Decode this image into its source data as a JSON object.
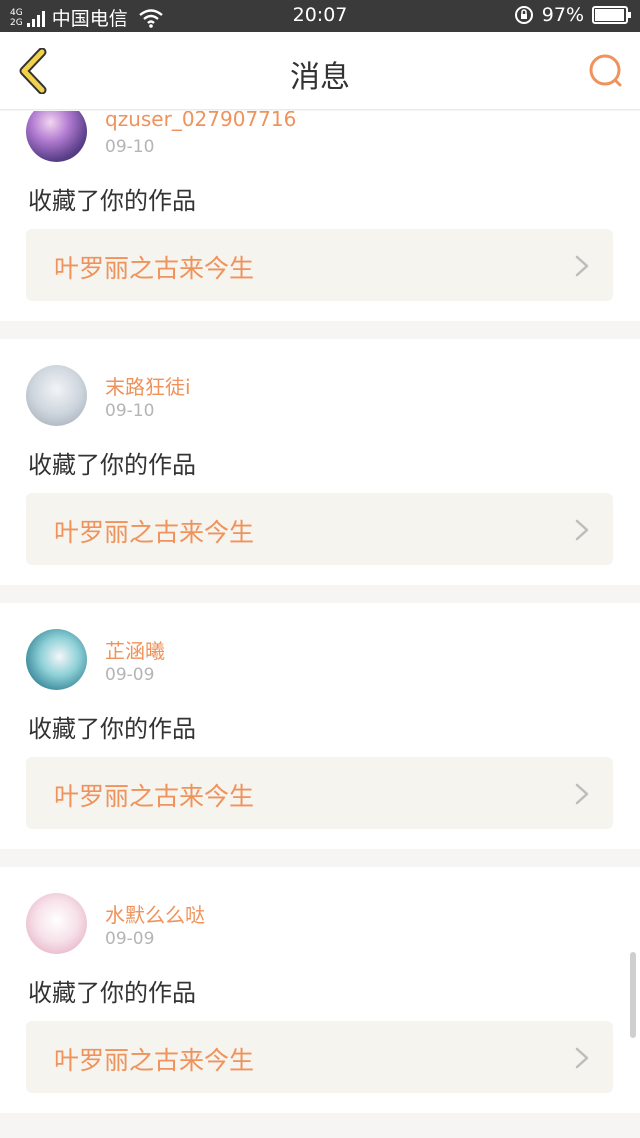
{
  "status_bar": {
    "network_top": "4G",
    "network_bottom": "2G",
    "carrier": "中国电信",
    "time": "20:07",
    "battery_percent": "97%",
    "battery_level": 0.97
  },
  "header": {
    "title": "消息",
    "back_icon": "chevron-left-icon",
    "search_icon": "search-icon"
  },
  "colors": {
    "accent": "#f0925b",
    "back_icon": "#f2d24a"
  },
  "messages": [
    {
      "username": "qzuser_027907716",
      "date": "09-10",
      "action": "收藏了你的作品",
      "work_title": "叶罗丽之古来今生",
      "avatar": "a"
    },
    {
      "username": "末路狂徒i",
      "date": "09-10",
      "action": "收藏了你的作品",
      "work_title": "叶罗丽之古来今生",
      "avatar": "b"
    },
    {
      "username": "芷涵曦",
      "date": "09-09",
      "action": "收藏了你的作品",
      "work_title": "叶罗丽之古来今生",
      "avatar": "c"
    },
    {
      "username": "水默么么哒",
      "date": "09-09",
      "action": "收藏了你的作品",
      "work_title": "叶罗丽之古来今生",
      "avatar": "d"
    }
  ]
}
